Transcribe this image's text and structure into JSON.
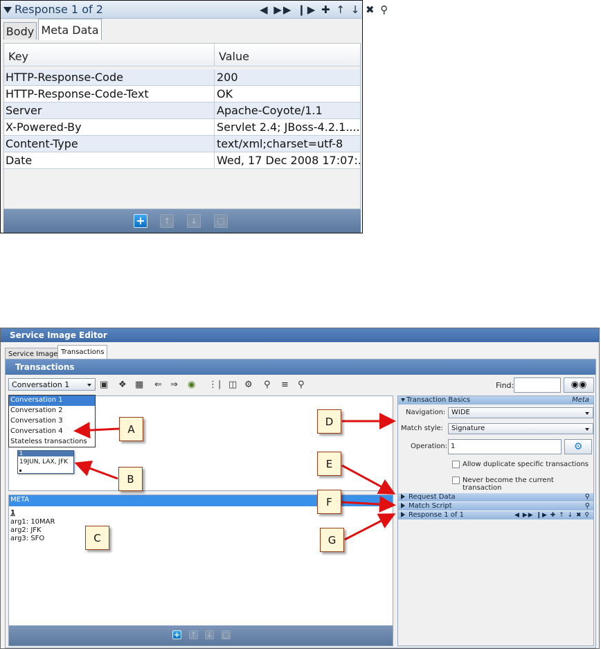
{
  "top": {
    "header": {
      "title": "Response 1 of 2",
      "nav_icons": "◀ ▶▶ ❙▶ ✚ ↑ ↓ ✖ ⚲"
    },
    "tabs": [
      {
        "label": "Body"
      },
      {
        "label": "Meta Data"
      }
    ],
    "columns": {
      "key": "Key",
      "value": "Value"
    },
    "rows": [
      {
        "key": "HTTP-Response-Code",
        "value": "200"
      },
      {
        "key": "HTTP-Response-Code-Text",
        "value": "OK"
      },
      {
        "key": "Server",
        "value": "Apache-Coyote/1.1"
      },
      {
        "key": "X-Powered-By",
        "value": "Servlet 2.4; JBoss-4.2.1...."
      },
      {
        "key": "Content-Type",
        "value": "text/xml;charset=utf-8"
      },
      {
        "key": "Date",
        "value": "Wed, 17 Dec 2008 17:07:..."
      }
    ]
  },
  "editor": {
    "window_title": "Service Image Editor",
    "tabs": [
      {
        "label": "Service Image"
      },
      {
        "label": "Transactions"
      }
    ],
    "panel_title": "Transactions",
    "conversation_select": "Conversation 1",
    "find_label": "Find:",
    "dropdown_options": [
      "Conversation 1",
      "Conversation 2",
      "Conversation 3",
      "Conversation 4",
      "Stateless transactions"
    ],
    "node": {
      "number": "1",
      "text": "19JUN, LAX, JFK"
    },
    "meta": {
      "header": "META",
      "number": "1",
      "args": [
        "arg1: 10MAR",
        "arg2: JFK",
        "arg3: SFO"
      ]
    },
    "transaction_basics": {
      "title": "Transaction Basics",
      "meta_label": "Meta",
      "navigation_label": "Navigation:",
      "navigation_value": "WIDE",
      "match_style_label": "Match style:",
      "match_style_value": "Signature",
      "operation_label": "Operation:",
      "operation_value": "1",
      "allow_duplicate": "Allow duplicate specific transactions",
      "never_current": "Never become the current transaction"
    },
    "sections": [
      {
        "label": "Request Data"
      },
      {
        "label": "Match Script"
      },
      {
        "label": "Response 1 of 1"
      }
    ]
  },
  "callouts": [
    "A",
    "B",
    "C",
    "D",
    "E",
    "F",
    "G"
  ],
  "colors": {
    "header_blue": "#4b77b0",
    "selection_blue": "#3a8fe8",
    "arrow_red": "#e01010",
    "callout_fill": "#fff7d6"
  }
}
